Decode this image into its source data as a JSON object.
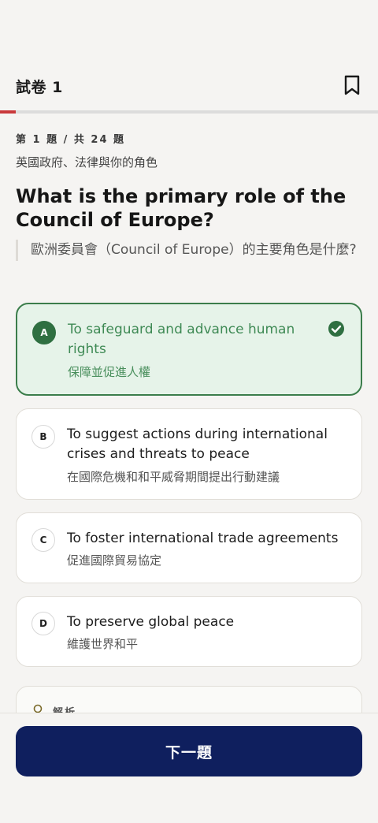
{
  "header": {
    "title": "試卷 1"
  },
  "progress": {
    "current": 1,
    "total": 24,
    "fraction": 0.0417
  },
  "question": {
    "counter": "第 1 題 / 共 24 題",
    "category": "英國政府、法律與你的角色",
    "text_en": "What is the primary role of the Council of Europe?",
    "text_zh": "歐洲委員會（Council of Europe）的主要角色是什麼?"
  },
  "options": [
    {
      "letter": "A",
      "en": "To safeguard and advance human rights",
      "zh": "保障並促進人權",
      "correct": true
    },
    {
      "letter": "B",
      "en": "To suggest actions during international crises and threats to peace",
      "zh": "在國際危機和和平威脅期間提出行動建議",
      "correct": false
    },
    {
      "letter": "C",
      "en": "To foster international trade agreements",
      "zh": "促進國際貿易協定",
      "correct": false
    },
    {
      "letter": "D",
      "en": "To preserve global peace",
      "zh": "維護世界和平",
      "correct": false
    }
  ],
  "explanation": {
    "label": "解析"
  },
  "footer": {
    "next_label": "下一題"
  },
  "colors": {
    "accent": "#c9393b",
    "correct": "#2f6f41",
    "primary_button": "#0f1f5e"
  },
  "icons": {
    "bookmark": "bookmark-icon",
    "check": "check-circle-icon",
    "explanation": "lightbulb-icon"
  }
}
